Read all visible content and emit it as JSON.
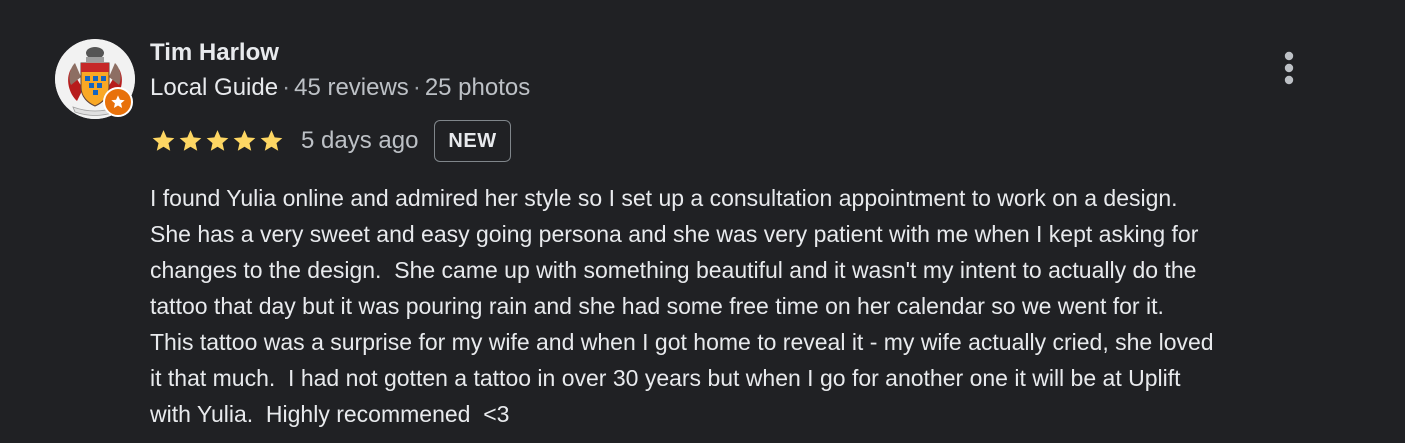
{
  "review": {
    "author_name": "Tim Harlow",
    "author_badge": "Local Guide",
    "review_count": "45 reviews",
    "photo_count": "25 photos",
    "separator": "·",
    "rating": 5,
    "rating_max": 5,
    "time_ago": "5 days ago",
    "new_badge": "NEW",
    "body_lines": [
      "I found Yulia online and admired her style so I set up a consultation appointment to work on a design.",
      "She has a very sweet and easy going persona and she was very patient with me when I kept asking for",
      "changes to the design.  She came up with something beautiful and it wasn't my intent to actually do the",
      "tattoo that day but it was pouring rain and she had some free time on her calendar so we went for it.",
      "This tattoo was a surprise for my wife and when I got home to reveal it - my wife actually cried, she loved",
      "it that much.  I had not gotten a tattoo in over 30 years but when I go for another one it will be at Uplift",
      "with Yulia.  Highly recommened  <3"
    ]
  },
  "icons": {
    "avatar": "coat-of-arms-avatar",
    "guide_badge": "local-guide-star-icon",
    "star": "star-icon",
    "more": "more-vert-icon"
  },
  "colors": {
    "background": "#202124",
    "primary_text": "#e8eaed",
    "secondary_text": "#bdc1c6",
    "star": "#fdd663",
    "guide_badge": "#e8710a"
  }
}
